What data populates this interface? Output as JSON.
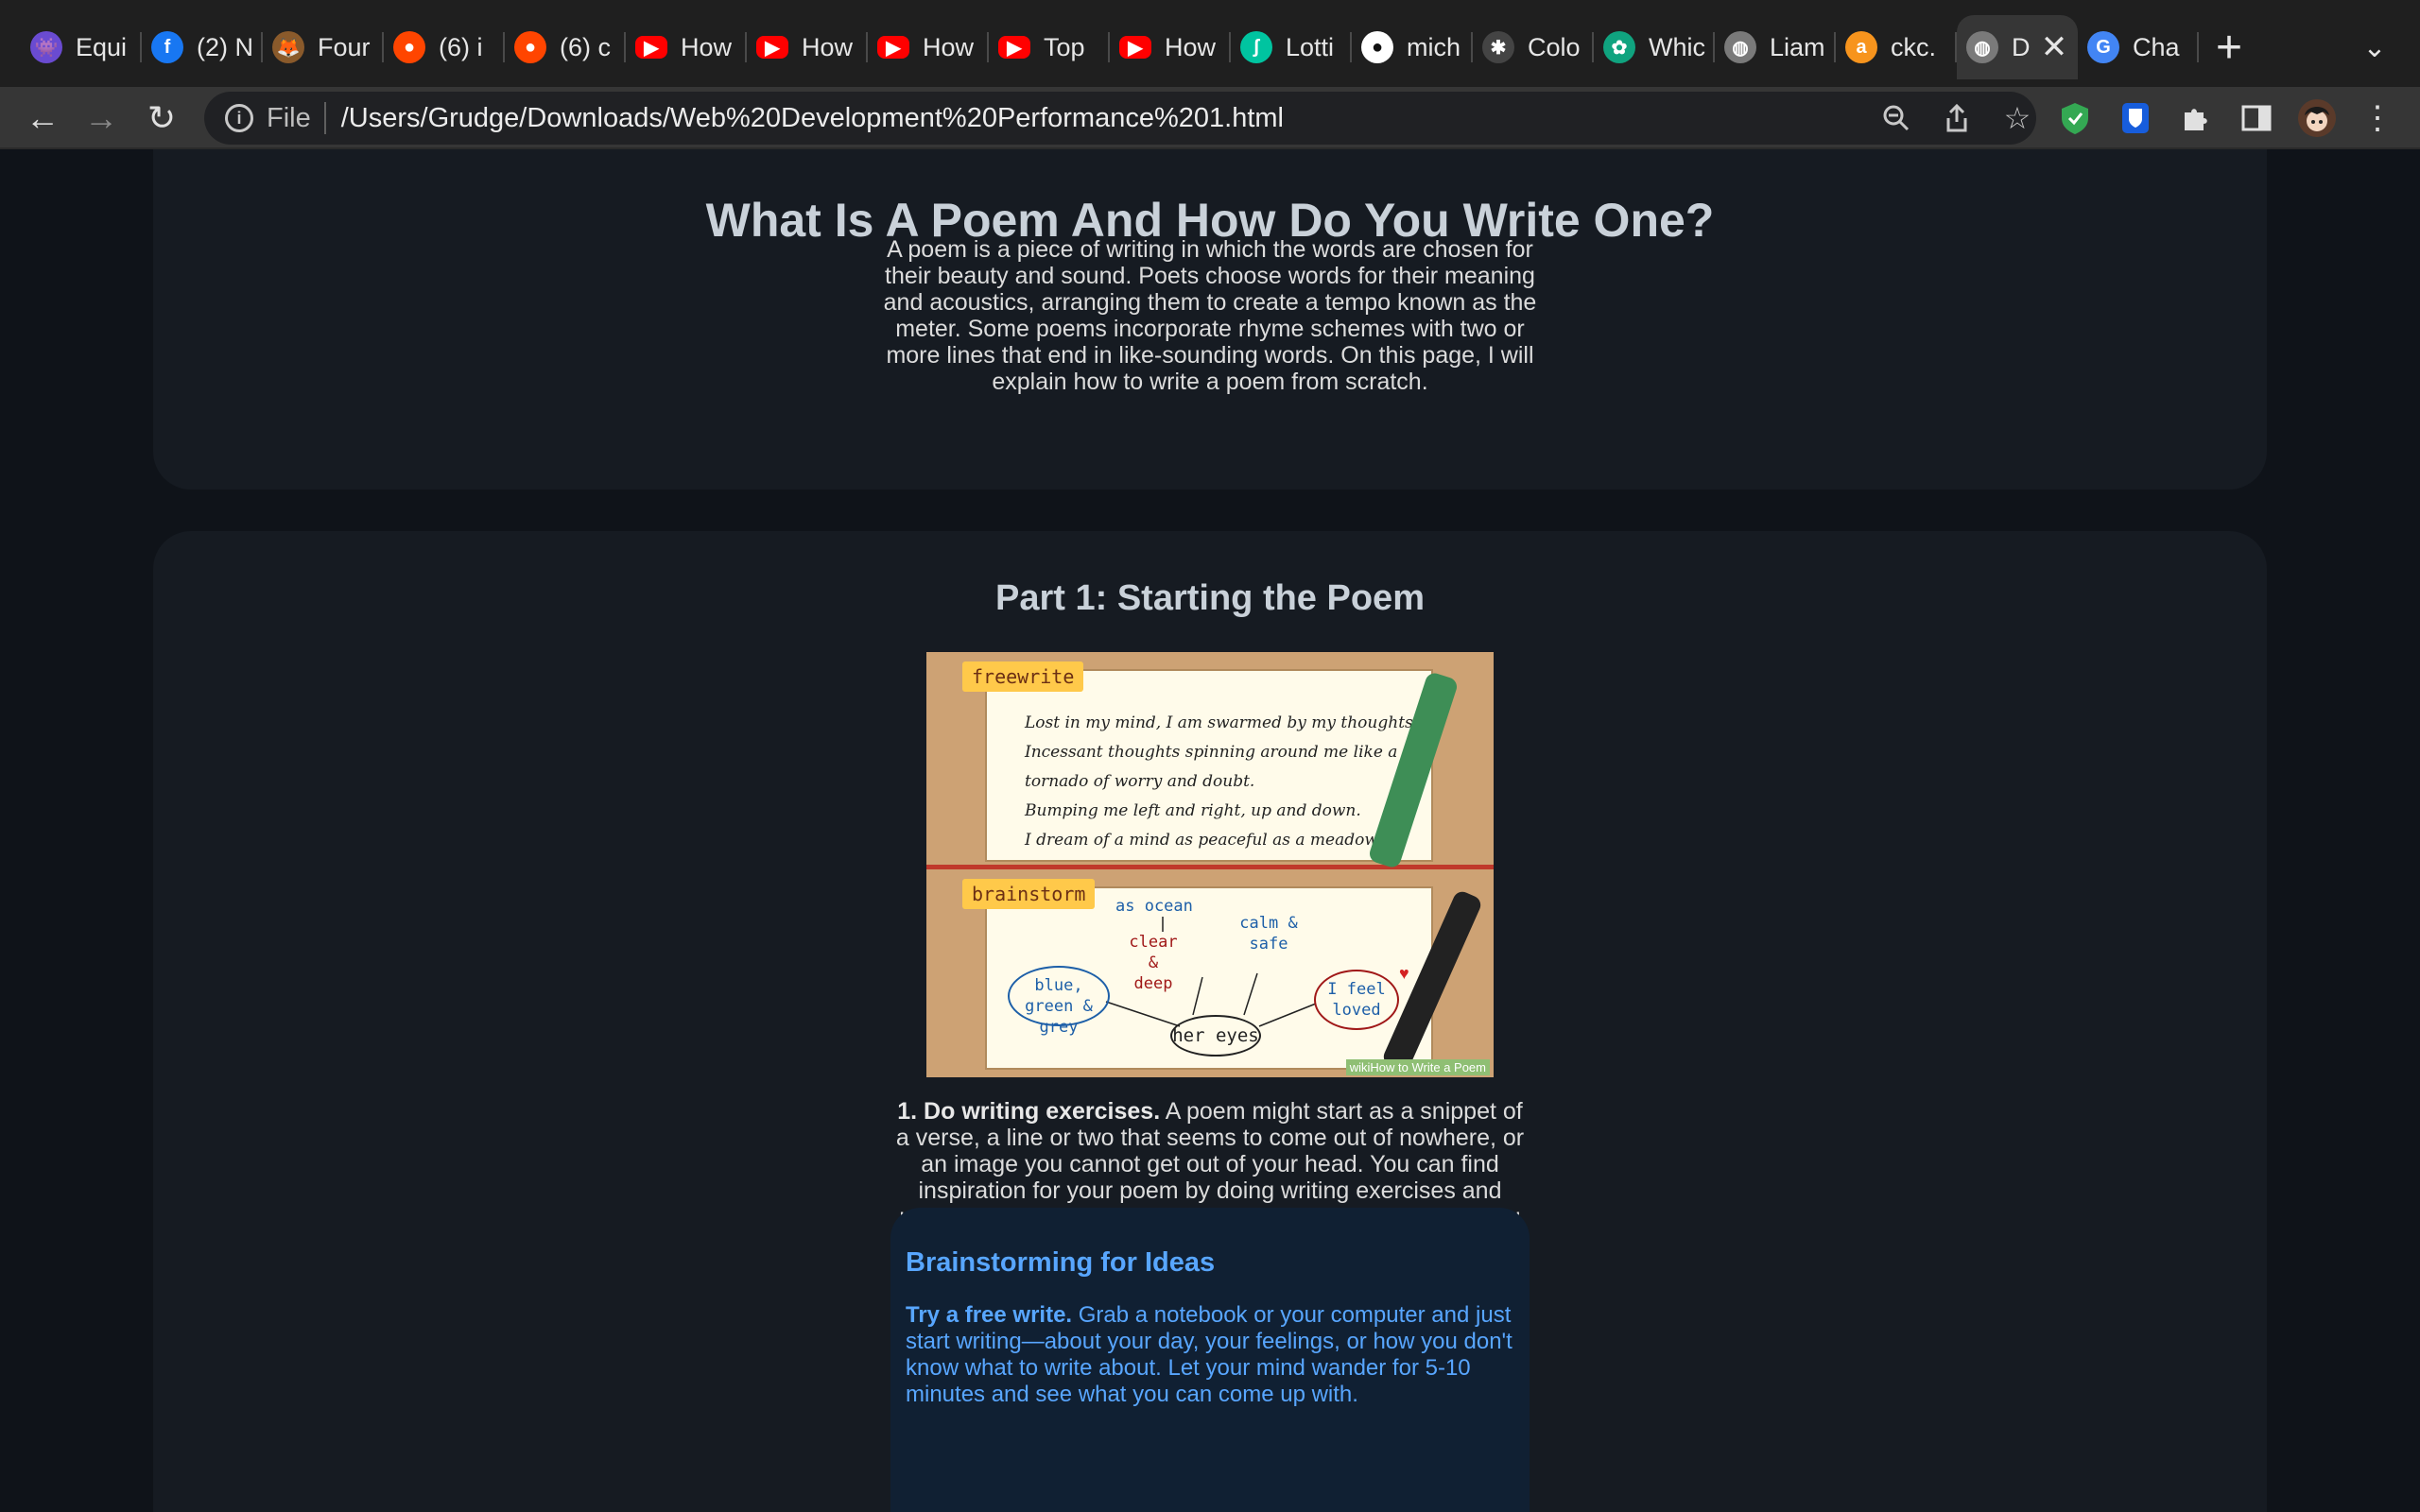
{
  "browser": {
    "tabs": [
      {
        "label": "Equi",
        "icon": "alien-icon",
        "color": "#6a4bd1"
      },
      {
        "label": "(2) N",
        "icon": "facebook-icon",
        "color": "#1877f2"
      },
      {
        "label": "Four",
        "icon": "fox-icon",
        "color": "#8a5a2b"
      },
      {
        "label": "(6) i",
        "icon": "reddit-icon",
        "color": "#ff4500"
      },
      {
        "label": "(6) c",
        "icon": "reddit-icon",
        "color": "#ff4500"
      },
      {
        "label": "How",
        "icon": "youtube-icon",
        "color": "#ff0000"
      },
      {
        "label": "How",
        "icon": "youtube-icon",
        "color": "#ff0000"
      },
      {
        "label": "How",
        "icon": "youtube-icon",
        "color": "#ff0000"
      },
      {
        "label": "Top",
        "icon": "youtube-icon",
        "color": "#ff0000"
      },
      {
        "label": "How",
        "icon": "youtube-icon",
        "color": "#ff0000"
      },
      {
        "label": "Lotti",
        "icon": "lottie-icon",
        "color": "#00c4a0"
      },
      {
        "label": "mich",
        "icon": "github-icon",
        "color": "#ffffff"
      },
      {
        "label": "Colo",
        "icon": "color-icon",
        "color": "#444444"
      },
      {
        "label": "Whic",
        "icon": "chatgpt-icon",
        "color": "#10a37f"
      },
      {
        "label": "Liam",
        "icon": "globe-icon",
        "color": "#7a7a7a"
      },
      {
        "label": "ckc.",
        "icon": "avast-icon",
        "color": "#f7941d"
      },
      {
        "label": "D",
        "icon": "globe-icon",
        "color": "#7a7a7a",
        "active": true
      },
      {
        "label": "Cha",
        "icon": "google-icon",
        "color": "#4285f4"
      }
    ],
    "url_scheme_label": "File",
    "url": "/Users/Grudge/Downloads/Web%20Development%20Performance%201.html"
  },
  "intro": {
    "title": "What Is A Poem And How Do You Write One?",
    "paragraph": "A poem is a piece of writing in which the words are chosen for their beauty and sound. Poets choose words for their meaning and acoustics, arranging them to create a tempo known as the meter. Some poems incorporate rhyme schemes with two or more lines that end in like-sounding words. On this page, I will explain how to write a poem from scratch."
  },
  "part1": {
    "title": "Part 1: Starting the Poem",
    "illustration": {
      "tag_freewrite": "freewrite",
      "tag_brainstorm": "brainstorm",
      "poem_lines": [
        "Lost in my mind, I am swarmed by my thoughts.",
        "Incessant thoughts spinning around me like a",
        "tornado of worry and doubt.",
        "Bumping me left and right, up and down.",
        "I dream of a mind as peaceful as a meadow."
      ],
      "bubble_ocean": "as ocean",
      "bubble_clear": "clear & deep",
      "bubble_calm": "calm & safe",
      "bubble_blue": "blue, green & grey",
      "bubble_loved": "I feel loved",
      "bubble_eyes": "her eyes",
      "pen_brand": "wikiHow",
      "watermark": "wikiHow to Write a Poem"
    },
    "step1_bold": "1. Do writing exercises.",
    "step1_text": " A poem might start as a snippet of a verse, a line or two that seems to come out of nowhere, or an image you cannot get out of your head. You can find inspiration for your poem by doing writing exercises and using the world around you. Once you have inspiration, you can then shape and mould your thoughts into a poem.",
    "brainstorm": {
      "title": "Brainstorming for Ideas",
      "bold": "Try a free write.",
      "text": " Grab a notebook or your computer and just start writing—about your day, your feelings, or how you don't know what to write about. Let your mind wander for 5-10 minutes and see what you can come up with."
    }
  }
}
